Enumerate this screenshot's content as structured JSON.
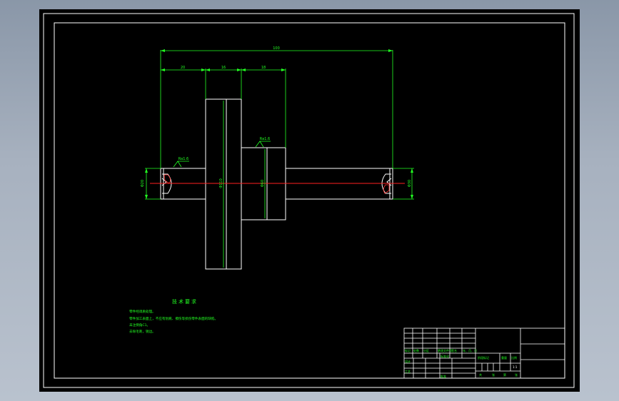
{
  "dimensions": {
    "overall": "100",
    "seg_left": "20",
    "seg_mid": "16",
    "seg_right": "18",
    "dia_left": "Φ20",
    "dia_flange": "Φ110",
    "dia_hub": "Φ60",
    "dia_right": "Φ30"
  },
  "roughness": {
    "left": "Ra1.6",
    "hub": "Ra1.6"
  },
  "tech_req": {
    "title": "技术要求",
    "lines": [
      "零件经调质处理。",
      "零件加工表面上，不应有划痕、擦伤等损伤零件表面的缺陷。",
      "未注倒角C1。",
      "去除毛刺，锐边。"
    ]
  },
  "title_block": {
    "revision_labels": [
      "标记",
      "处数",
      "分区",
      "更改文件号",
      "签名",
      "年、月、日"
    ],
    "stage_label": "阶段标记",
    "weight_label": "重量",
    "scale_label": "比例",
    "scale_value": "1:1",
    "standardize_label": "标准化",
    "design_label": "设计",
    "process_label": "工艺",
    "approve_label": "批准",
    "sheet_labels": [
      "共",
      "张",
      "第",
      "张"
    ]
  }
}
